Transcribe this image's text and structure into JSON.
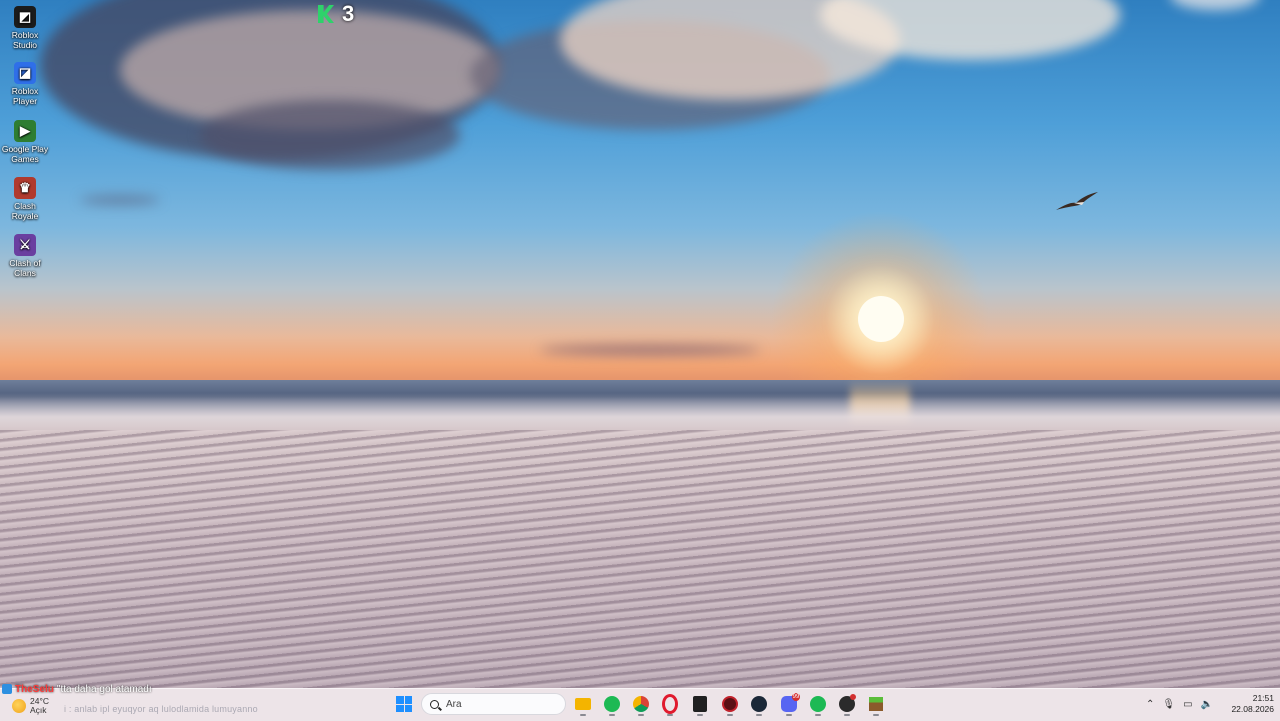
{
  "desktop_icons": [
    {
      "label": "Roblox Studio",
      "icon": "roblox-studio-icon",
      "color": "#1b1b1b"
    },
    {
      "label": "Roblox Player",
      "icon": "roblox-player-icon",
      "color": "#2f6fe8"
    },
    {
      "label": "Google Play Games",
      "icon": "google-play-games-icon",
      "color": "#2e7d32"
    },
    {
      "label": "Clash Royale",
      "icon": "clash-royale-icon",
      "color": "#b03a2e"
    },
    {
      "label": "Clash of Clans",
      "icon": "clash-of-clans-icon",
      "color": "#6a3fa0"
    }
  ],
  "overlay": {
    "counter": "3",
    "accent": "#2ed26b"
  },
  "ticker": {
    "source": "TheSelu",
    "message": "\"tta daha gol atamadı",
    "secondary": "i : anlab ipl eyuqyor aq lulodlamida lumuyanno"
  },
  "weather": {
    "temp": "24°C",
    "condition": "Açık"
  },
  "taskbar": {
    "search_placeholder": "Ara",
    "apps": [
      {
        "name": "file-explorer",
        "color": "#f4b400"
      },
      {
        "name": "spotify",
        "color": "#1db954"
      },
      {
        "name": "chrome",
        "color": "#db4437"
      },
      {
        "name": "opera",
        "color": "#e0192d"
      },
      {
        "name": "epic-games",
        "color": "#202020"
      },
      {
        "name": "app-red-circle",
        "color": "#5a0f14"
      },
      {
        "name": "steam",
        "color": "#1b2838"
      },
      {
        "name": "discord",
        "color": "#5865f2",
        "badge": "99"
      },
      {
        "name": "spotify-2",
        "color": "#1db954"
      },
      {
        "name": "app-dark",
        "color": "#2b2b2b"
      },
      {
        "name": "minecraft",
        "color": "#4caf50"
      }
    ]
  },
  "clock": {
    "time": "21:51",
    "date": "22.08.2026"
  },
  "tray": {
    "chevron": "⌃",
    "mic": "🎙",
    "display": "▭",
    "volume": "🔈"
  }
}
